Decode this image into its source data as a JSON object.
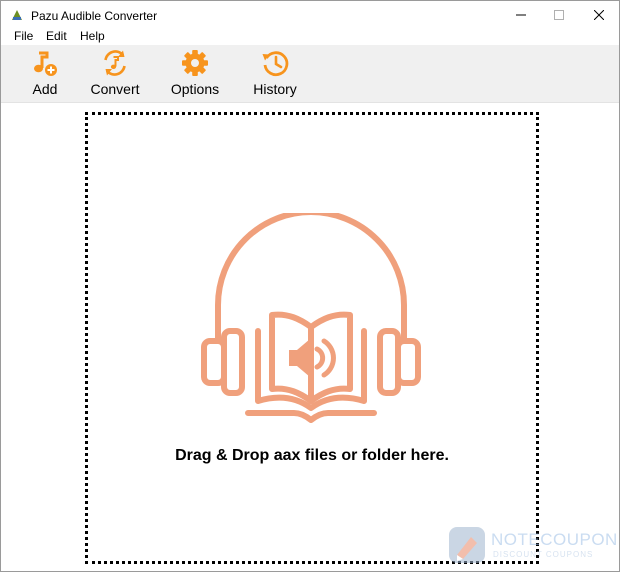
{
  "window": {
    "title": "Pazu Audible Converter",
    "icon": "app-icon"
  },
  "menu": {
    "items": [
      {
        "label": "File"
      },
      {
        "label": "Edit"
      },
      {
        "label": "Help"
      }
    ]
  },
  "toolbar": {
    "buttons": [
      {
        "label": "Add",
        "icon": "music-add-icon"
      },
      {
        "label": "Convert",
        "icon": "convert-icon"
      },
      {
        "label": "Options",
        "icon": "gear-icon"
      },
      {
        "label": "History",
        "icon": "history-icon"
      }
    ]
  },
  "dropzone": {
    "text": "Drag & Drop aax files or folder here.",
    "illustration": "headphones-audiobook-icon"
  },
  "watermark": {
    "main": "NOTECOUPON",
    "sub": "DISCOUNT COUPONS"
  },
  "colors": {
    "accent": "#f7941d",
    "illustration": "#f0a07c",
    "toolbar_bg": "#f0f0f0"
  }
}
